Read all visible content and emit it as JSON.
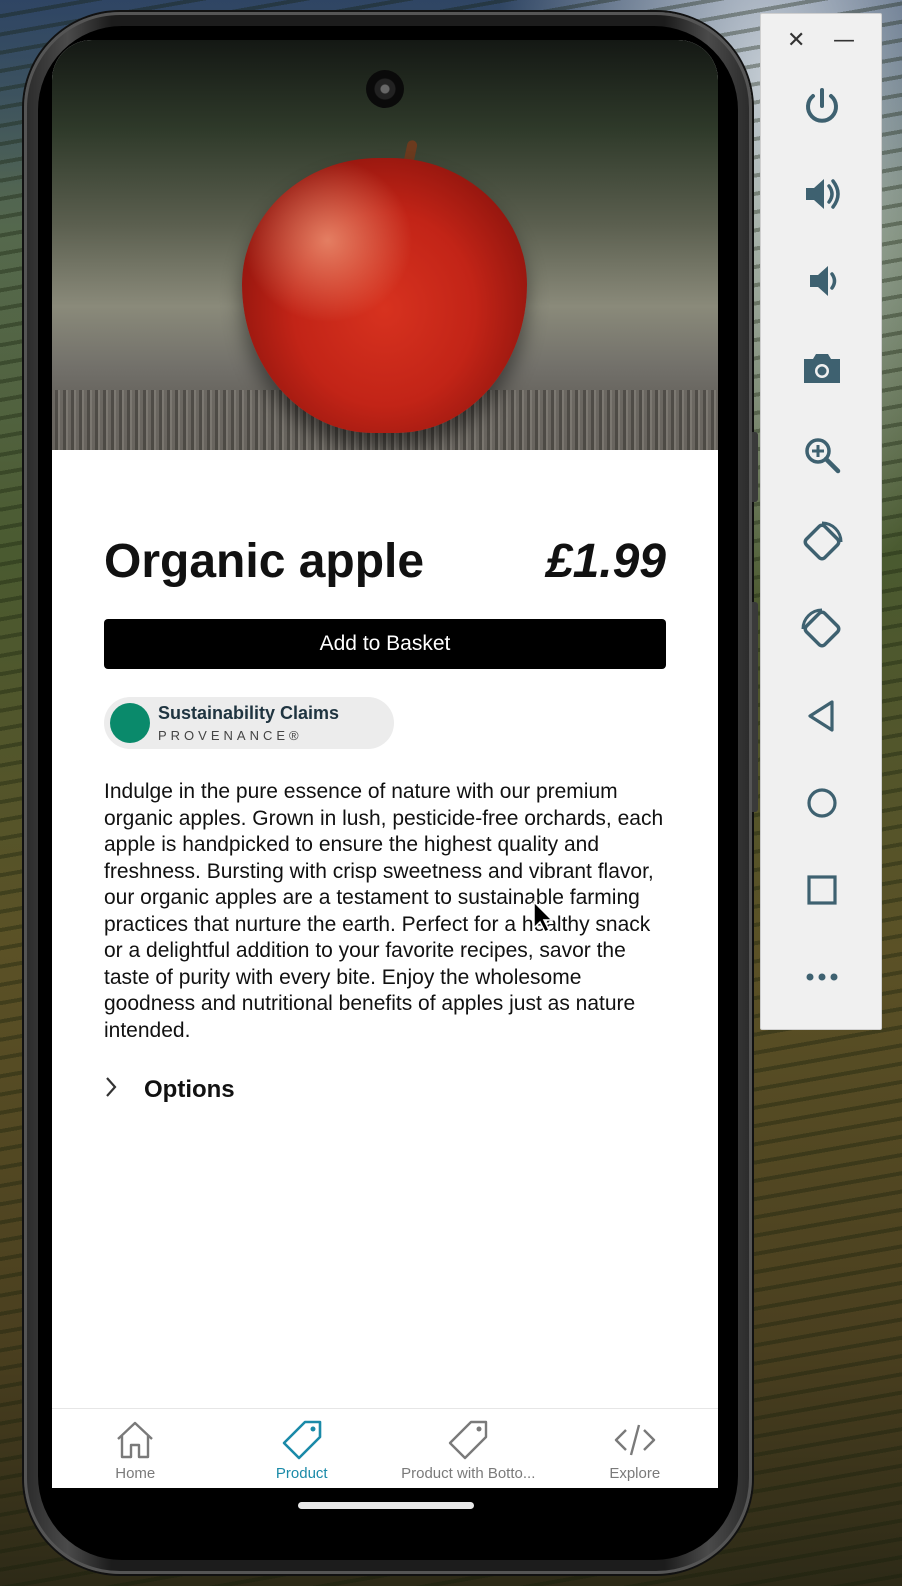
{
  "product": {
    "title": "Organic apple",
    "price": "£1.99",
    "add_to_basket": "Add to Basket",
    "sustainability": {
      "title": "Sustainability Claims",
      "subtitle": "PROVENANCE®",
      "dot_color": "#0a8a6b"
    },
    "description": "Indulge in the pure essence of nature with our premium organic apples. Grown in lush, pesticide-free orchards, each apple is handpicked to ensure the highest quality and freshness. Bursting with crisp sweetness and vibrant flavor, our organic apples are a testament to sustainable farming practices that nurture the earth. Perfect for a healthy snack or a delightful addition to your favorite recipes, savor the taste of purity with every bite. Enjoy the wholesome goodness and nutritional benefits of apples just as nature intended.",
    "options_label": "Options"
  },
  "tabbar": {
    "active_color": "#1a8aa8",
    "tabs": [
      {
        "label": "Home",
        "icon": "home-icon",
        "active": false
      },
      {
        "label": "Product",
        "icon": "tag-icon",
        "active": true
      },
      {
        "label": "Product with Botto...",
        "icon": "tag-icon",
        "active": false
      },
      {
        "label": "Explore",
        "icon": "code-icon",
        "active": false
      }
    ]
  },
  "emulator_toolbar": {
    "close_glyph": "✕",
    "minimize_glyph": "—",
    "buttons": [
      "power-icon",
      "volume-up-icon",
      "volume-down-icon",
      "camera-icon",
      "zoom-icon",
      "rotate-left-icon",
      "rotate-right-icon",
      "back-icon",
      "home-circle-icon",
      "overview-icon",
      "more-icon"
    ]
  }
}
